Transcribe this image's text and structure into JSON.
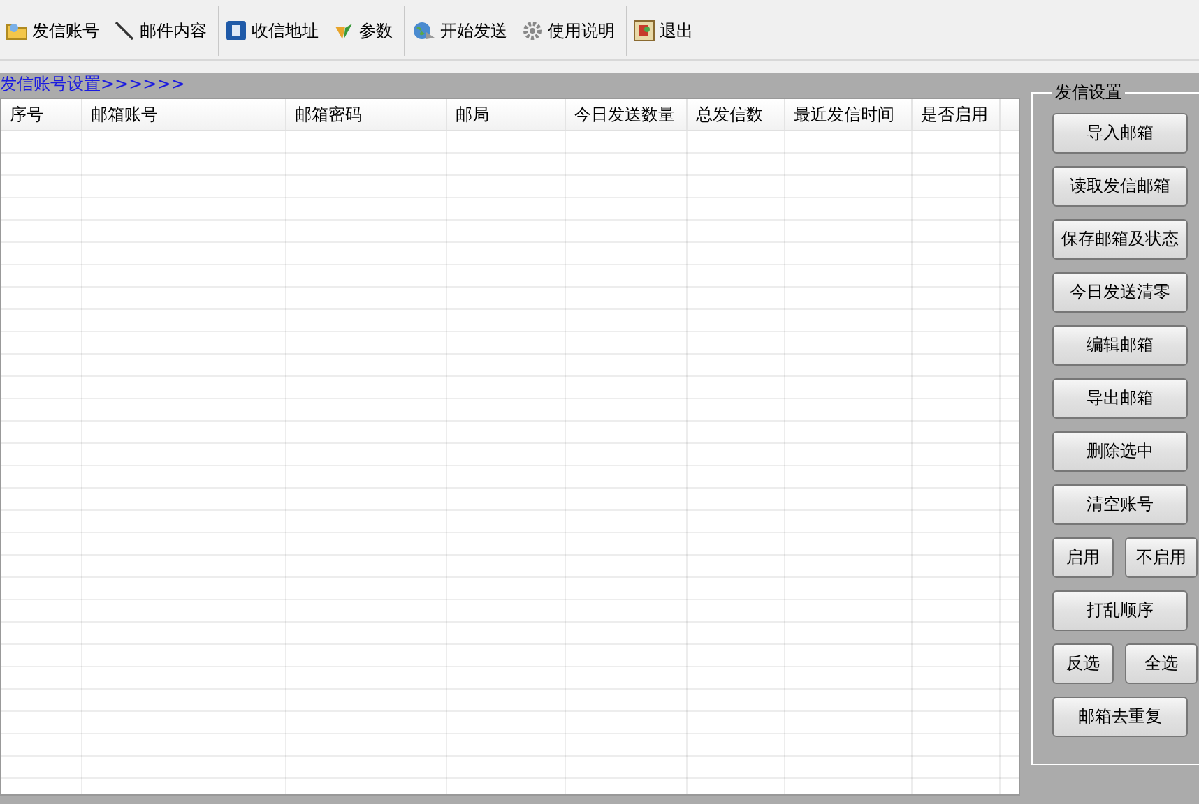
{
  "toolbar": [
    {
      "items": [
        {
          "label": "发信账号"
        },
        {
          "label": "邮件内容"
        }
      ]
    },
    {
      "items": [
        {
          "label": "收信地址"
        },
        {
          "label": "参数"
        }
      ]
    },
    {
      "items": [
        {
          "label": "开始发送"
        },
        {
          "label": "使用说明"
        }
      ]
    },
    {
      "items": [
        {
          "label": "退出"
        }
      ]
    }
  ],
  "section_title": "发信账号设置>>>>>>",
  "table": {
    "columns": [
      "序号",
      "邮箱账号",
      "邮箱密码",
      "邮局",
      "今日发送数量",
      "总发信数",
      "最近发信时间",
      "是否启用"
    ]
  },
  "panel": {
    "title": "发信设置",
    "rows": [
      [
        "导入邮箱"
      ],
      [
        "读取发信邮箱"
      ],
      [
        "保存邮箱及状态"
      ],
      [
        "今日发送清零"
      ],
      [
        "编辑邮箱"
      ],
      [
        "导出邮箱"
      ],
      [
        "删除选中"
      ],
      [
        "清空账号"
      ],
      [
        "启用",
        "不启用"
      ],
      [
        "打乱顺序"
      ],
      [
        "反选",
        "全选"
      ],
      [
        "邮箱去重复"
      ]
    ]
  }
}
